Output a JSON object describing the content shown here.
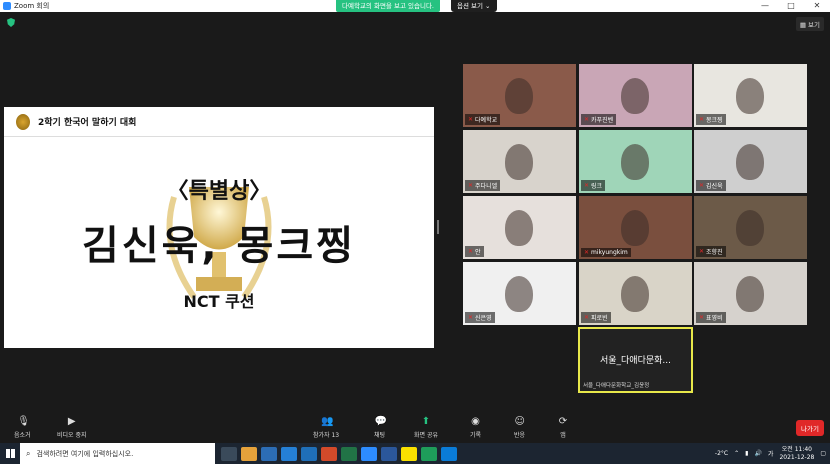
{
  "window": {
    "title": "Zoom 회의",
    "controls": [
      "—",
      "□",
      "✕"
    ]
  },
  "share_banner": "다예학교의 화면을 보고 있습니다.",
  "view_options": "옵션 보기 ⌄",
  "view_button": "보기",
  "slide": {
    "header": "2학기 한국어 말하기 대회",
    "award": "〈특별상〉",
    "names": "김신욱, 몽크찡",
    "song": "NCT 쿠션"
  },
  "participants": [
    {
      "name": "다예학교",
      "color": "#8a5a4a"
    },
    {
      "name": "카푸진벤",
      "color": "#c9a6b6"
    },
    {
      "name": "몽크찡",
      "color": "#e8e6e0"
    },
    {
      "name": "주다니엘",
      "color": "#d8d3cc"
    },
    {
      "name": "링크",
      "color": "#9fd5b8"
    },
    {
      "name": "김신욱",
      "color": "#cfcfcf"
    },
    {
      "name": "안",
      "color": "#e6e0dc"
    },
    {
      "name": "mikyungkim",
      "color": "#7a4f3e"
    },
    {
      "name": "조향진",
      "color": "#6c5a48"
    },
    {
      "name": "신은영",
      "color": "#f0f0f0"
    },
    {
      "name": "피로빈",
      "color": "#d9d4c8"
    },
    {
      "name": "표영비",
      "color": "#d6d2cd"
    }
  ],
  "active_speaker": {
    "display": "서울_다애다문화...",
    "name": "서울_다애다문화학교_김윤정"
  },
  "controls": {
    "mute": "음소거",
    "video": "비디오 중지",
    "participants": "참가자",
    "participants_count": "13",
    "chat": "채팅",
    "share": "화면 공유",
    "record": "기록",
    "reactions": "반응",
    "apps": "앱",
    "leave": "나가기"
  },
  "taskbar": {
    "search_placeholder": "검색하려면 여기에 입력하십시오.",
    "weather": "-2°C",
    "time": "오전 11:40",
    "date": "2021-12-28",
    "lang": "가"
  }
}
